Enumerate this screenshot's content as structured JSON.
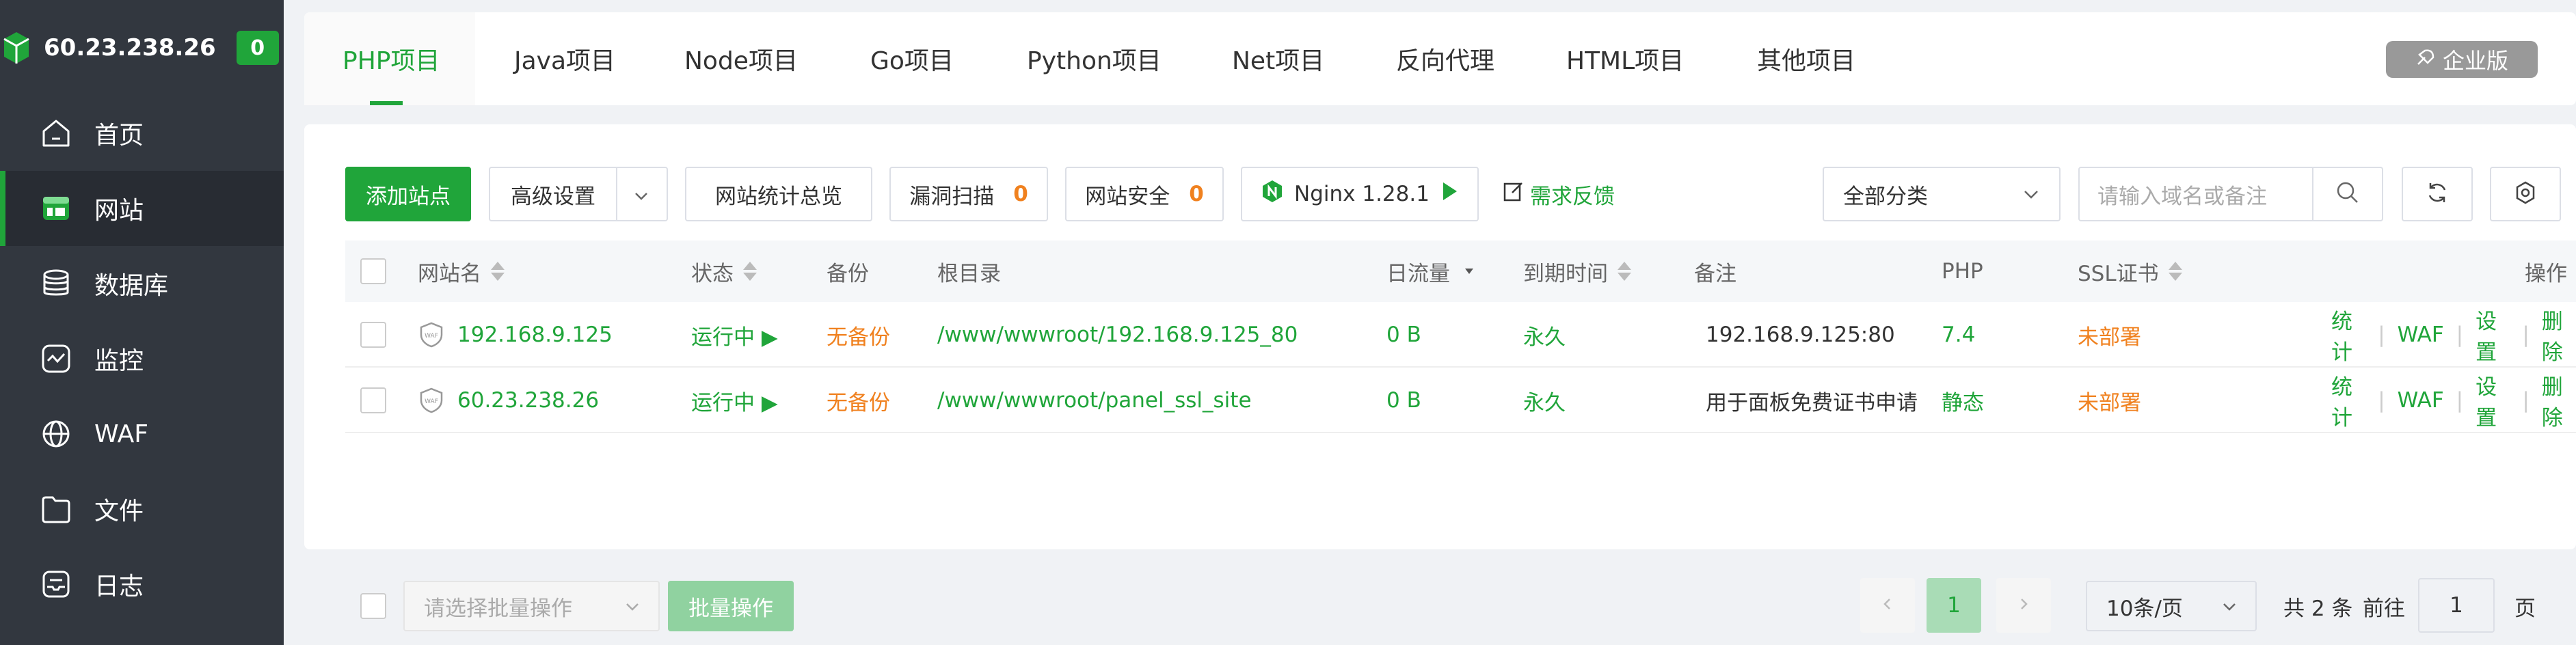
{
  "sidebar": {
    "server_ip": "60.23.238.26",
    "badge": "0",
    "items": [
      {
        "label": "首页",
        "icon": "home-icon"
      },
      {
        "label": "网站",
        "icon": "website-icon"
      },
      {
        "label": "数据库",
        "icon": "database-icon"
      },
      {
        "label": "监控",
        "icon": "monitor-icon"
      },
      {
        "label": "WAF",
        "icon": "waf-globe-icon"
      },
      {
        "label": "文件",
        "icon": "folder-icon"
      },
      {
        "label": "日志",
        "icon": "log-icon"
      }
    ],
    "active_index": 1
  },
  "tabs": {
    "items": [
      "PHP项目",
      "Java项目",
      "Node项目",
      "Go项目",
      "Python项目",
      "Net项目",
      "反向代理",
      "HTML项目",
      "其他项目"
    ],
    "active_index": 0,
    "enterprise_label": "企业版"
  },
  "toolbar": {
    "add_site": "添加站点",
    "advanced": "高级设置",
    "stats_overview": "网站统计总览",
    "vuln_scan": "漏洞扫描",
    "vuln_count": "0",
    "site_security": "网站安全",
    "security_count": "0",
    "nginx": "Nginx 1.28.1",
    "feedback": "需求反馈",
    "category": "全部分类",
    "search_placeholder": "请输入域名或备注"
  },
  "table": {
    "headers": {
      "name": "网站名",
      "status": "状态",
      "backup": "备份",
      "root": "根目录",
      "traffic": "日流量",
      "expire": "到期时间",
      "note": "备注",
      "php": "PHP",
      "ssl": "SSL证书",
      "ops": "操作"
    },
    "rows": [
      {
        "name": "192.168.9.125",
        "status": "运行中 ▶",
        "backup": "无备份",
        "root": "/www/wwwroot/192.168.9.125_80",
        "traffic": "0 B",
        "expire": "永久",
        "note": "192.168.9.125:80",
        "php": "7.4",
        "ssl": "未部署"
      },
      {
        "name": "60.23.238.26",
        "status": "运行中 ▶",
        "backup": "无备份",
        "root": "/www/wwwroot/panel_ssl_site",
        "traffic": "0 B",
        "expire": "永久",
        "note": "用于面板免费证书申请",
        "php": "静态",
        "ssl": "未部署"
      }
    ],
    "ops": [
      "统计",
      "WAF",
      "设置",
      "删除"
    ]
  },
  "footer": {
    "batch_placeholder": "请选择批量操作",
    "batch_button": "批量操作",
    "current_page": "1",
    "page_size": "10条/页",
    "total": "共 2 条",
    "goto_prefix": "前往",
    "goto_value": "1",
    "goto_suffix": "页"
  },
  "colors": {
    "accent": "#20a53a",
    "warning": "#f0811f",
    "sidebar_bg": "#32373f"
  }
}
